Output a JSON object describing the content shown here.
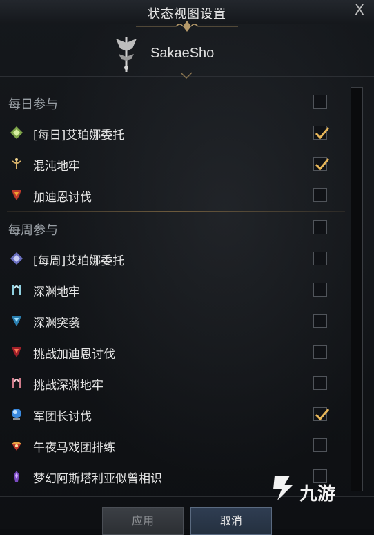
{
  "window": {
    "title": "状态视图设置",
    "close_glyph": "X"
  },
  "header": {
    "character_name": "SakaeSho",
    "class_icon": "class-emblem-icon"
  },
  "sections": [
    {
      "title": "每日参与",
      "checked": false,
      "items": [
        {
          "label": "[每日]艾珀娜委托",
          "icon": "diamond-emblem-icon",
          "checked": true
        },
        {
          "label": "混沌地牢",
          "icon": "chaos-dungeon-icon",
          "checked": true
        },
        {
          "label": "加迪恩讨伐",
          "icon": "guardian-raid-icon",
          "checked": false
        }
      ]
    },
    {
      "title": "每周参与",
      "checked": false,
      "items": [
        {
          "label": "[每周]艾珀娜委托",
          "icon": "diamond-emblem-icon",
          "checked": false
        },
        {
          "label": "深渊地牢",
          "icon": "abyss-dungeon-icon",
          "checked": false
        },
        {
          "label": "深渊突袭",
          "icon": "abyss-raid-icon",
          "checked": false
        },
        {
          "label": "挑战加迪恩讨伐",
          "icon": "challenge-guardian-icon",
          "checked": false
        },
        {
          "label": "挑战深渊地牢",
          "icon": "challenge-abyss-icon",
          "checked": false
        },
        {
          "label": "军团长讨伐",
          "icon": "legion-commander-icon",
          "checked": true
        },
        {
          "label": "午夜马戏团排练",
          "icon": "circus-icon",
          "checked": false
        },
        {
          "label": "梦幻阿斯塔利亚似曾相识",
          "icon": "dream-icon",
          "checked": false
        }
      ]
    }
  ],
  "buttons": {
    "apply": "应用",
    "cancel": "取消"
  },
  "watermark": {
    "text": "九游"
  },
  "colors": {
    "check": "#e8b75a",
    "accent_gold": "#b59a6a"
  }
}
